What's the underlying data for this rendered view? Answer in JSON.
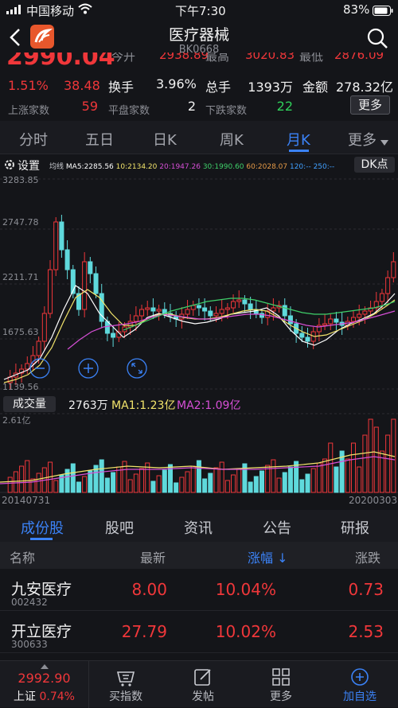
{
  "status": {
    "carrier": "中国移动",
    "time": "下午7:30",
    "battery": "83%"
  },
  "header": {
    "title": "医疗器械",
    "code": "BK0668"
  },
  "quote": {
    "price": "2990.04",
    "partial_labels": [
      "今开",
      "最高",
      "最低"
    ],
    "partial_values": [
      "2938.89",
      "3020.83",
      "2876.09"
    ],
    "change_pct": "1.51%",
    "change": "38.48",
    "turnover_label": "换手",
    "turnover": "3.96%",
    "volume_label": "总手",
    "volume": "1393万",
    "amount_label": "金额",
    "amount": "278.32亿",
    "up_label": "上涨家数",
    "up_count": "59",
    "flat_label": "平盘家数",
    "flat_count": "2",
    "down_label": "下跌家数",
    "down_count": "22",
    "more_button": "更多"
  },
  "period_tabs": [
    "分时",
    "五日",
    "日K",
    "周K",
    "月K",
    "更多"
  ],
  "active_period": "月K",
  "kline": {
    "settings_label": "设置",
    "ma_legend": [
      "均线",
      "MA5:2285.56",
      "10:2134.20",
      "20:1947.26",
      "30:1990.60",
      "60:2028.07",
      "120:--",
      "250:--"
    ],
    "ma_colors": [
      "#c9cbd1",
      "#ffffff",
      "#f2e46b",
      "#d64fd6",
      "#3fd06a",
      "#e59a47",
      "#40a0ff",
      "#40a0ff"
    ],
    "dk_button": "DK点",
    "y_ticks": [
      "3283.85",
      "2747.78",
      "2211.71",
      "1675.63",
      "1139.56"
    ]
  },
  "volume": {
    "label": "成交量",
    "current": "2763万",
    "ma1": "MA1:1.23亿",
    "ma2": "MA2:1.09亿",
    "max": "2.61亿",
    "start_date": "20140731",
    "end_date": "20200303"
  },
  "list_tabs": [
    "成份股",
    "股吧",
    "资讯",
    "公告",
    "研报"
  ],
  "active_list_tab": "成份股",
  "list_header": {
    "name": "名称",
    "latest": "最新",
    "change_pct": "涨幅 ↓",
    "change": "涨跌"
  },
  "stocks": [
    {
      "name": "九安医疗",
      "code": "002432",
      "latest": "8.00",
      "change_pct": "10.04%",
      "change": "0.73"
    },
    {
      "name": "开立医疗",
      "code": "300633",
      "latest": "27.79",
      "change_pct": "10.02%",
      "change": "2.53"
    }
  ],
  "bottom_bar": {
    "index_value": "2992.90",
    "index_name": "上证",
    "index_change": "0.74%",
    "items": [
      "买指数",
      "发帖",
      "更多",
      "加自选"
    ]
  },
  "colors": {
    "up": "#f0373a",
    "down": "#5fd9dc",
    "accent": "#3b82f6",
    "bg": "#141519"
  }
}
